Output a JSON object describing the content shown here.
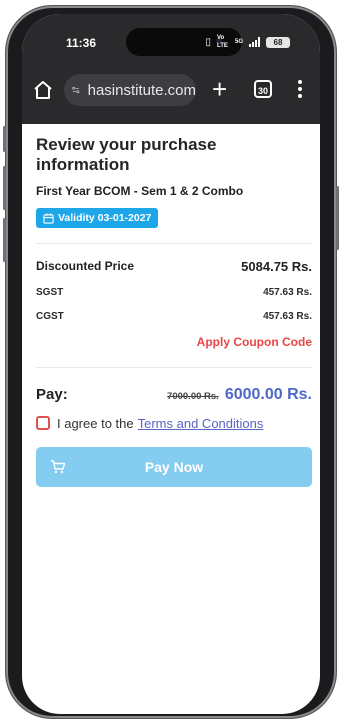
{
  "status": {
    "time": "11:36",
    "network": "Vo LTE",
    "signal": "5G",
    "battery": "68"
  },
  "browser": {
    "url": "hasinstitute.com",
    "tab_count": "30"
  },
  "page": {
    "title": "Review your purchase information",
    "course": "First Year BCOM - Sem 1 & 2 Combo",
    "validity": "Validity 03-01-2027",
    "discounted_label": "Discounted Price",
    "discounted_value": "5084.75 Rs.",
    "sgst_label": "SGST",
    "sgst_value": "457.63 Rs.",
    "cgst_label": "CGST",
    "cgst_value": "457.63 Rs.",
    "coupon": "Apply Coupon Code",
    "pay_label": "Pay:",
    "old_price": "7000.00 Rs.",
    "new_price": "6000.00 Rs.",
    "agree_text": "I agree to the",
    "terms_link": "Terms and Conditions",
    "pay_button": "Pay Now"
  },
  "colors": {
    "validity_badge": "#1ea7e8",
    "coupon": "#e94545",
    "price_accent": "#4d68c9",
    "pay_button": "#84ccf0"
  }
}
